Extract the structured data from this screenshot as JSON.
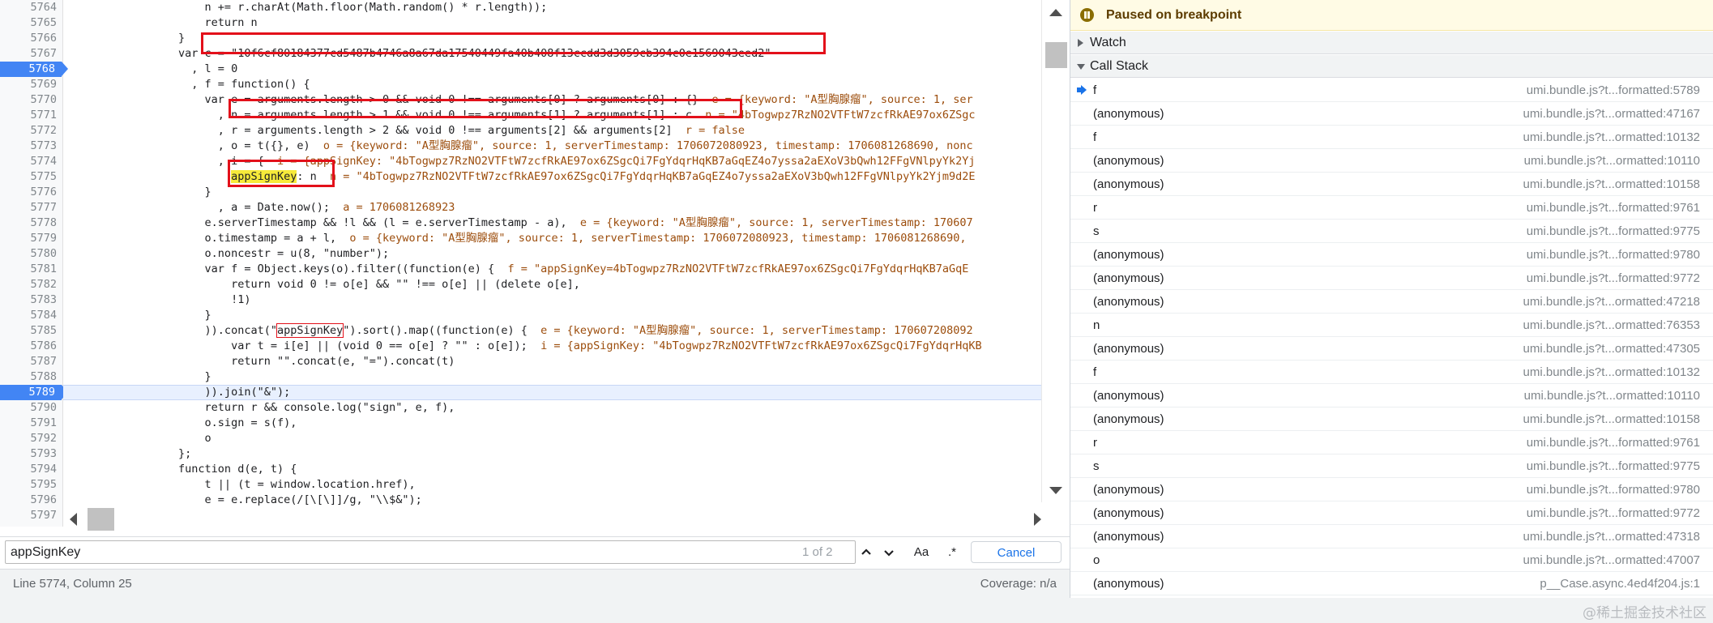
{
  "editor": {
    "gutter": [
      "5764",
      "5765",
      "5766",
      "5767",
      "5768",
      "5769",
      "5770",
      "5771",
      "5772",
      "5773",
      "5774",
      "5775",
      "5776",
      "5777",
      "5778",
      "5779",
      "5780",
      "5781",
      "5782",
      "5783",
      "5784",
      "5785",
      "5786",
      "5787",
      "5788",
      "5789",
      "5790",
      "5791",
      "5792",
      "5793",
      "5794",
      "5795",
      "5796",
      "5797"
    ],
    "breakpoint_lines": [
      "5768",
      "5789"
    ],
    "execution_line": "5789",
    "lines": [
      {
        "code": "                    n += r.charAt(Math.floor(Math.random() * r.length));",
        "inline": ""
      },
      {
        "code": "                    return n",
        "inline": ""
      },
      {
        "code": "                }",
        "inline": ""
      },
      {
        "code": "                var c = \"10f6cf80184377cd5487b4746a8a67da17540449fa40b408f13ccdd3d3059cb394c0e1569043eed2\"",
        "inline": ""
      },
      {
        "code": "                  , l = 0",
        "inline": ""
      },
      {
        "code": "                  , f = function() {",
        "inline": ""
      },
      {
        "code": "                    var e = arguments.length > 0 && void 0 !== arguments[0] ? arguments[0] : {}",
        "inline": "e = {keyword: \"A型胸腺瘤\", source: 1, ser"
      },
      {
        "code": "                      , n = arguments.length > 1 && void 0 !== arguments[1] ? arguments[1] : c",
        "inline": "n = \"4bTogwpz7RzNO2VTFtW7zcfRkAE97ox6ZSgc"
      },
      {
        "code": "                      , r = arguments.length > 2 && void 0 !== arguments[2] && arguments[2]",
        "inline": "r = false"
      },
      {
        "code": "                      , o = t({}, e)",
        "inline": "o = {keyword: \"A型胸腺瘤\", source: 1, serverTimestamp: 1706072080923, timestamp: 1706081268690, nonc"
      },
      {
        "code": "                      , i = {",
        "inline": "i = {appSignKey: \"4bTogwpz7RzNO2VTFtW7zcfRkAE97ox6ZSgcQi7FgYdqrHqKB7aGqEZ4o7yssa2aEXoV3bQwh12FFgVNlpyYk2Yj"
      },
      {
        "code": "                        appSignKey: n",
        "inline": "n = \"4bTogwpz7RzNO2VTFtW7zcfRkAE97ox6ZSgcQi7FgYdqrHqKB7aGqEZ4o7yssa2aEXoV3bQwh12FFgVNlpyYk2Yjm9d2E"
      },
      {
        "code": "                    }",
        "inline": ""
      },
      {
        "code": "                      , a = Date.now();",
        "inline": "a = 1706081268923"
      },
      {
        "code": "                    e.serverTimestamp && !l && (l = e.serverTimestamp - a),",
        "inline": "e = {keyword: \"A型胸腺瘤\", source: 1, serverTimestamp: 170607"
      },
      {
        "code": "                    o.timestamp = a + l,",
        "inline": "o = {keyword: \"A型胸腺瘤\", source: 1, serverTimestamp: 1706072080923, timestamp: 1706081268690,"
      },
      {
        "code": "                    o.noncestr = u(8, \"number\");",
        "inline": ""
      },
      {
        "code": "                    var f = Object.keys(o).filter((function(e) {",
        "inline": "f = \"appSignKey=4bTogwpz7RzNO2VTFtW7zcfRkAE97ox6ZSgcQi7FgYdqrHqKB7aGqE"
      },
      {
        "code": "                        return void 0 != o[e] && \"\" !== o[e] || (delete o[e],",
        "inline": ""
      },
      {
        "code": "                        !1)",
        "inline": ""
      },
      {
        "code": "                    }",
        "inline": ""
      },
      {
        "code": "                    )).concat(\"appSignKey\").sort().map((function(e) {",
        "inline": "e = {keyword: \"A型胸腺瘤\", source: 1, serverTimestamp: 170607208092"
      },
      {
        "code": "                        var t = i[e] || (void 0 == o[e] ? \"\" : o[e]);",
        "inline": "i = {appSignKey: \"4bTogwpz7RzNO2VTFtW7zcfRkAE97ox6ZSgcQi7FgYdqrHqKB"
      },
      {
        "code": "                        return \"\".concat(e, \"=\").concat(t)",
        "inline": ""
      },
      {
        "code": "                    }",
        "inline": ""
      },
      {
        "code": "                    )).join(\"&\");",
        "inline": ""
      },
      {
        "code": "                    return r && console.log(\"sign\", e, f),",
        "inline": ""
      },
      {
        "code": "                    o.sign = s(f),",
        "inline": ""
      },
      {
        "code": "                    o",
        "inline": ""
      },
      {
        "code": "                };",
        "inline": ""
      },
      {
        "code": "                function d(e, t) {",
        "inline": ""
      },
      {
        "code": "                    t || (t = window.location.href),",
        "inline": ""
      },
      {
        "code": "                    e = e.replace(/[\\[\\]]/g, \"\\\\$&\");",
        "inline": ""
      },
      {
        "code": "",
        "inline": ""
      }
    ]
  },
  "search": {
    "value": "appSignKey",
    "match_count": "1 of 2",
    "case_label": "Aa",
    "regex_label": ".*",
    "cancel_label": "Cancel"
  },
  "status": {
    "cursor": "Line 5774, Column 25",
    "coverage": "Coverage: n/a"
  },
  "debugger": {
    "paused": "Paused on breakpoint",
    "watch": "Watch",
    "call_stack": "Call Stack",
    "frames": [
      {
        "name": "f",
        "loc": "umi.bundle.js?t...formatted:5789",
        "current": true
      },
      {
        "name": "(anonymous)",
        "loc": "umi.bundle.js?t...ormatted:47167"
      },
      {
        "name": "f",
        "loc": "umi.bundle.js?t...ormatted:10132"
      },
      {
        "name": "(anonymous)",
        "loc": "umi.bundle.js?t...ormatted:10110"
      },
      {
        "name": "(anonymous)",
        "loc": "umi.bundle.js?t...ormatted:10158"
      },
      {
        "name": "r",
        "loc": "umi.bundle.js?t...formatted:9761"
      },
      {
        "name": "s",
        "loc": "umi.bundle.js?t...formatted:9775"
      },
      {
        "name": "(anonymous)",
        "loc": "umi.bundle.js?t...formatted:9780"
      },
      {
        "name": "(anonymous)",
        "loc": "umi.bundle.js?t...formatted:9772"
      },
      {
        "name": "(anonymous)",
        "loc": "umi.bundle.js?t...ormatted:47218"
      },
      {
        "name": "n",
        "loc": "umi.bundle.js?t...ormatted:76353"
      },
      {
        "name": "(anonymous)",
        "loc": "umi.bundle.js?t...ormatted:47305"
      },
      {
        "name": "f",
        "loc": "umi.bundle.js?t...ormatted:10132"
      },
      {
        "name": "(anonymous)",
        "loc": "umi.bundle.js?t...ormatted:10110"
      },
      {
        "name": "(anonymous)",
        "loc": "umi.bundle.js?t...ormatted:10158"
      },
      {
        "name": "r",
        "loc": "umi.bundle.js?t...formatted:9761"
      },
      {
        "name": "s",
        "loc": "umi.bundle.js?t...formatted:9775"
      },
      {
        "name": "(anonymous)",
        "loc": "umi.bundle.js?t...formatted:9780"
      },
      {
        "name": "(anonymous)",
        "loc": "umi.bundle.js?t...formatted:9772"
      },
      {
        "name": "(anonymous)",
        "loc": "umi.bundle.js?t...ormatted:47318"
      },
      {
        "name": "o",
        "loc": "umi.bundle.js?t...ormatted:47007"
      },
      {
        "name": "(anonymous)",
        "loc": "p__Case.async.4ed4f204.js:1"
      }
    ]
  },
  "watermark": "@稀土掘金技术社区",
  "colors": {
    "breakpoint": "#4285f4",
    "annotation_box": "#e3101a",
    "search_highlight": "#f7ea3a",
    "paused_banner": "#fffbe5",
    "inline_value": "#9c4d0c"
  }
}
